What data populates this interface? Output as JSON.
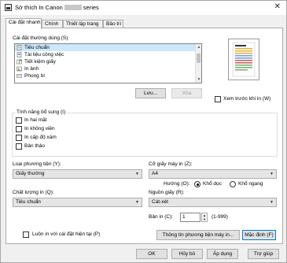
{
  "window": {
    "title_prefix": "Sở thích In Canon",
    "title_suffix": "series"
  },
  "tabs": [
    "Cài đặt nhanh",
    "Chính",
    "Thiết lập trang",
    "Bảo trì"
  ],
  "common_settings": {
    "title": "Cài đặt thường dùng (S)",
    "items": [
      "Tiêu chuẩn",
      "Tài liệu công việc",
      "Tiết kiệm giấy",
      "In ảnh",
      "Phong bì"
    ],
    "save_label": "Lưu...",
    "delete_label": "Xóa"
  },
  "preview": {
    "label": "Xem trước khi in (W)"
  },
  "additional_features": {
    "title": "Tính năng bổ sung (I)",
    "items": [
      "In hai mặt",
      "In không viền",
      "In cấp độ xám",
      "Bản thảo"
    ]
  },
  "media_type": {
    "label": "Loại phương tiện (Y):",
    "value": "Giấy thường"
  },
  "quality": {
    "label": "Chất lượng in (Q):",
    "value": "Tiêu chuẩn"
  },
  "paper_size": {
    "label": "Cỡ giấy máy in (Z):",
    "value": "A4"
  },
  "orientation": {
    "label": "Hướng (O):",
    "portrait": "Khổ dọc",
    "landscape": "Khổ ngang"
  },
  "paper_source": {
    "label": "Nguồn giấy (R):",
    "value": "Cát-xét"
  },
  "copies": {
    "label": "Bản in (C):",
    "value": "1",
    "range": "(1-999)"
  },
  "always_print": "Luôn in với cài đặt hiện tại (P)",
  "media_info_button": "Thông tin phương tiện máy in...",
  "defaults_button": "Mặc định (F)",
  "footer": {
    "ok": "OK",
    "cancel": "Hủy bỏ",
    "apply": "Áp dụng",
    "help": "Trợ giúp"
  },
  "colors": {
    "accent": "#0078d7",
    "selected_row": "#cce8ff"
  }
}
